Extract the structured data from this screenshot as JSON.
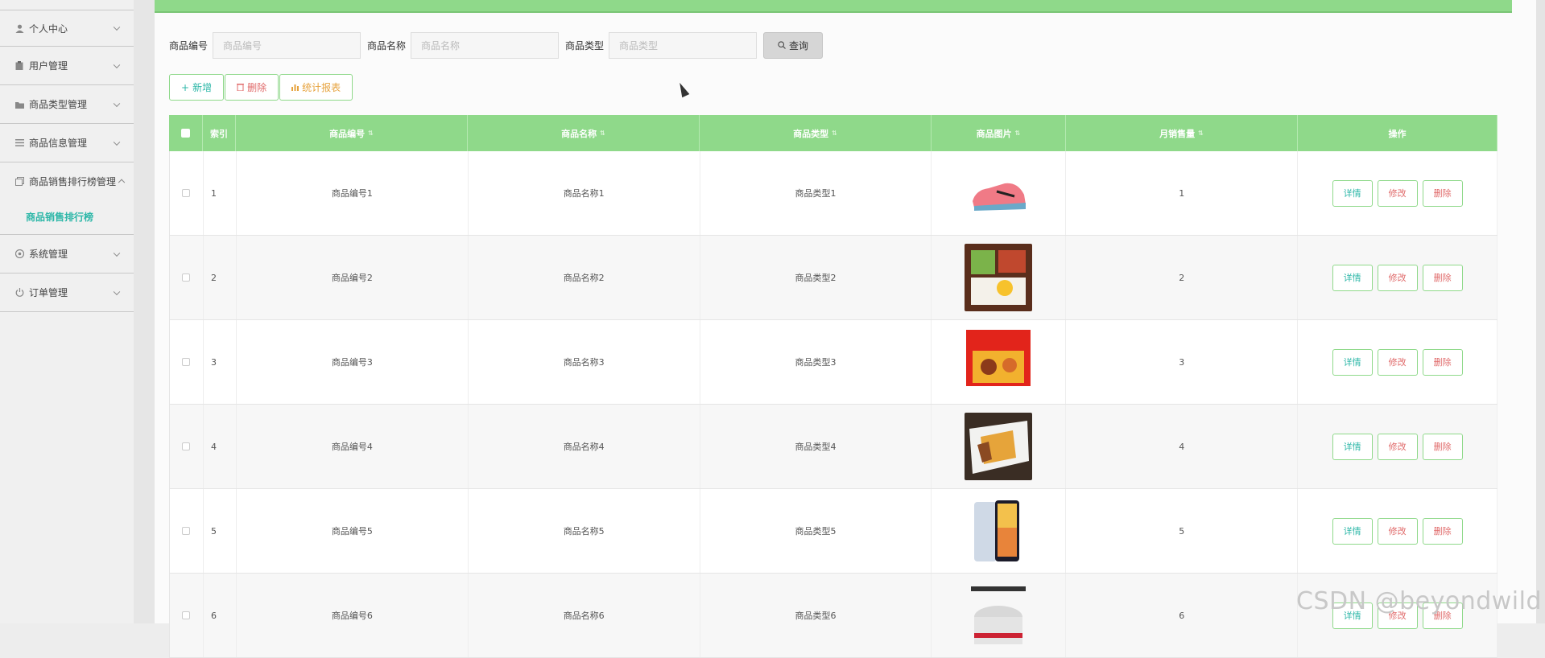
{
  "sidebar": {
    "items": [
      {
        "label": "个人中心",
        "icon": "user-icon"
      },
      {
        "label": "用户管理",
        "icon": "clipboard-icon"
      },
      {
        "label": "商品类型管理",
        "icon": "folder-icon"
      },
      {
        "label": "商品信息管理",
        "icon": "list-icon"
      },
      {
        "label": "商品销售排行榜管理",
        "icon": "copy-icon"
      }
    ],
    "submenu_label": "商品销售排行榜",
    "items_after": [
      {
        "label": "系统管理",
        "icon": "settings-icon"
      },
      {
        "label": "订单管理",
        "icon": "power-icon"
      }
    ]
  },
  "search": {
    "code_label": "商品编号",
    "code_placeholder": "商品编号",
    "name_label": "商品名称",
    "name_placeholder": "商品名称",
    "type_label": "商品类型",
    "type_placeholder": "商品类型",
    "query_label": "查询"
  },
  "actions": {
    "add_label": "新增",
    "delete_label": "删除",
    "stats_label": "统计报表"
  },
  "table": {
    "headers": [
      "索引",
      "商品编号",
      "商品名称",
      "商品类型",
      "商品图片",
      "月销售量",
      "操作"
    ],
    "rows": [
      {
        "index": "1",
        "code": "商品编号1",
        "name": "商品名称1",
        "type": "商品类型1",
        "image": "pink-sneaker",
        "sales": "1"
      },
      {
        "index": "2",
        "code": "商品编号2",
        "name": "商品名称2",
        "type": "商品类型2",
        "image": "bento-box",
        "sales": "2"
      },
      {
        "index": "3",
        "code": "商品编号3",
        "name": "商品名称3",
        "type": "商品类型3",
        "image": "snack-box",
        "sales": "3"
      },
      {
        "index": "4",
        "code": "商品编号4",
        "name": "商品名称4",
        "type": "商品类型4",
        "image": "fries-box",
        "sales": "4"
      },
      {
        "index": "5",
        "code": "商品编号5",
        "name": "商品名称5",
        "type": "商品类型5",
        "image": "smartphone",
        "sales": "5"
      },
      {
        "index": "6",
        "code": "商品编号6",
        "name": "商品名称6",
        "type": "商品类型6",
        "image": "rice-cooker",
        "sales": "6"
      }
    ],
    "op_detail": "详情",
    "op_edit": "修改",
    "op_delete": "删除"
  },
  "watermark": "CSDN @beyondwild",
  "colors": {
    "accent": "#8fd98a",
    "teal": "#2db7a8",
    "danger": "#e06a6a",
    "warning": "#e6a23c"
  }
}
